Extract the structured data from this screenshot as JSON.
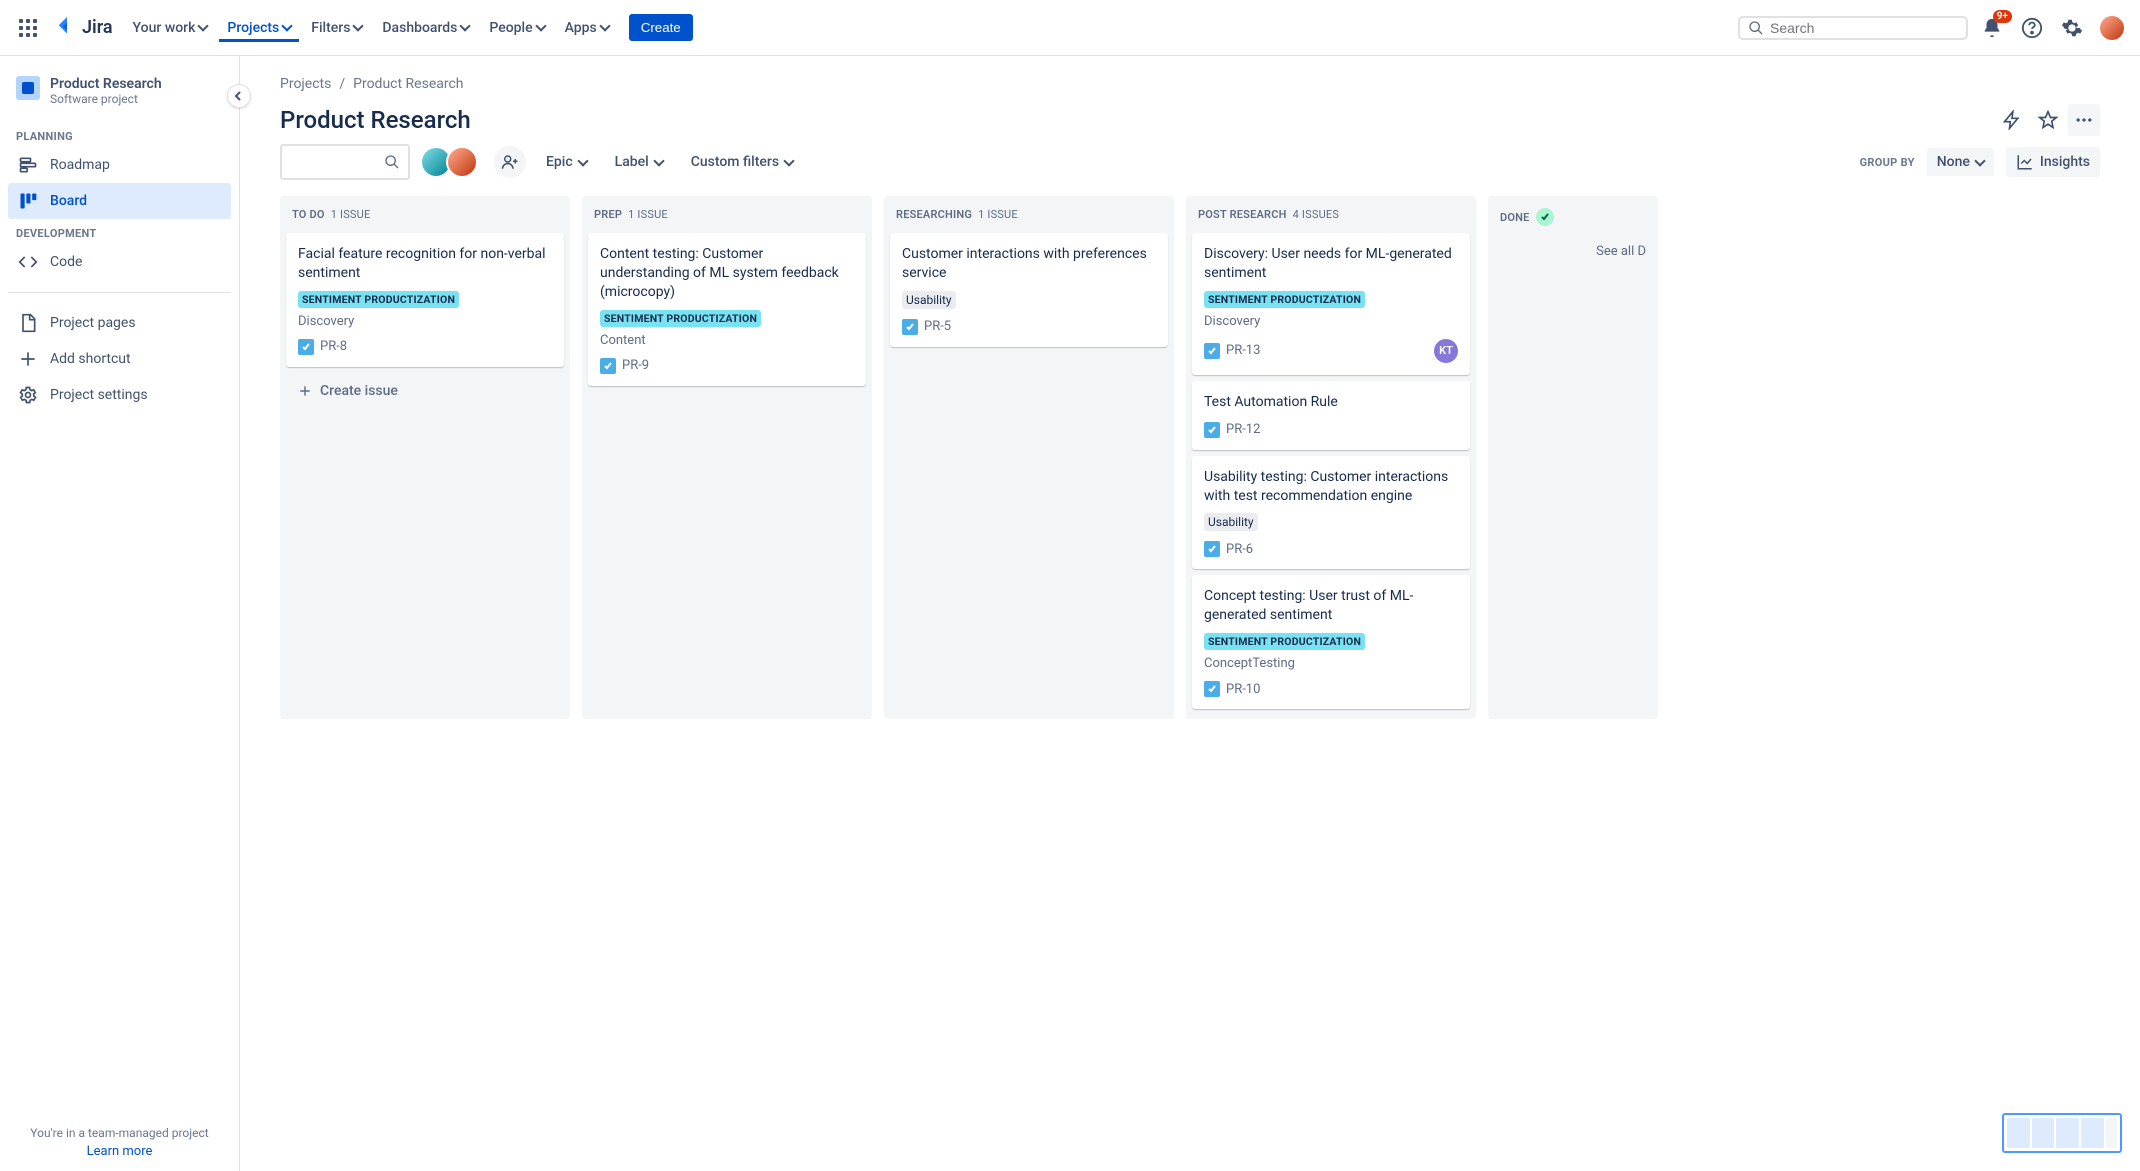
{
  "topnav": {
    "logo_text": "Jira",
    "items": [
      {
        "label": "Your work"
      },
      {
        "label": "Projects",
        "active": true
      },
      {
        "label": "Filters"
      },
      {
        "label": "Dashboards"
      },
      {
        "label": "People"
      },
      {
        "label": "Apps"
      }
    ],
    "create_label": "Create",
    "search_placeholder": "Search",
    "notification_badge": "9+"
  },
  "sidebar": {
    "project_title": "Product Research",
    "project_sub": "Software project",
    "sections": {
      "planning_label": "PLANNING",
      "planning_items": [
        {
          "label": "Roadmap"
        },
        {
          "label": "Board",
          "active": true
        }
      ],
      "development_label": "DEVELOPMENT",
      "development_items": [
        {
          "label": "Code"
        }
      ],
      "misc_items": [
        {
          "label": "Project pages"
        },
        {
          "label": "Add shortcut"
        },
        {
          "label": "Project settings"
        }
      ]
    },
    "footer_text": "You're in a team-managed project",
    "learn_more": "Learn more"
  },
  "breadcrumb": {
    "root": "Projects",
    "project": "Product Research"
  },
  "page_title": "Product Research",
  "toolbar": {
    "epic": "Epic",
    "label": "Label",
    "custom_filters": "Custom filters",
    "group_by": "GROUP BY",
    "group_value": "None",
    "insights": "Insights"
  },
  "columns": [
    {
      "name": "TO DO",
      "count_label": "1 ISSUE",
      "cards": [
        {
          "title": "Facial feature recognition for non-verbal sentiment",
          "tag_type": "sp",
          "tag_text": "SENTIMENT PRODUCTIZATION",
          "sub": "Discovery",
          "key": "PR-8"
        }
      ],
      "show_create": true
    },
    {
      "name": "PREP",
      "count_label": "1 ISSUE",
      "cards": [
        {
          "title": "Content testing: Customer understanding of ML system feedback (microcopy)",
          "tag_type": "sp",
          "tag_text": "SENTIMENT PRODUCTIZATION",
          "sub": "Content",
          "key": "PR-9"
        }
      ]
    },
    {
      "name": "RESEARCHING",
      "count_label": "1 ISSUE",
      "cards": [
        {
          "title": "Customer interactions with preferences service",
          "tag_type": "us",
          "tag_text": "Usability",
          "key": "PR-5"
        }
      ]
    },
    {
      "name": "POST RESEARCH",
      "count_label": "4 ISSUES",
      "cards": [
        {
          "title": "Discovery: User needs for ML-generated sentiment",
          "tag_type": "sp",
          "tag_text": "SENTIMENT PRODUCTIZATION",
          "sub": "Discovery",
          "key": "PR-13",
          "assignee": "KT"
        },
        {
          "title": "Test Automation Rule",
          "key": "PR-12"
        },
        {
          "title": "Usability testing: Customer interactions with test recommendation engine",
          "tag_type": "us",
          "tag_text": "Usability",
          "key": "PR-6"
        },
        {
          "title": "Concept testing: User trust of ML-generated sentiment",
          "tag_type": "sp",
          "tag_text": "SENTIMENT PRODUCTIZATION",
          "sub": "ConceptTesting",
          "key": "PR-10"
        }
      ]
    }
  ],
  "done_column": {
    "name": "DONE",
    "see_all": "See all D"
  },
  "create_issue_label": "Create issue"
}
